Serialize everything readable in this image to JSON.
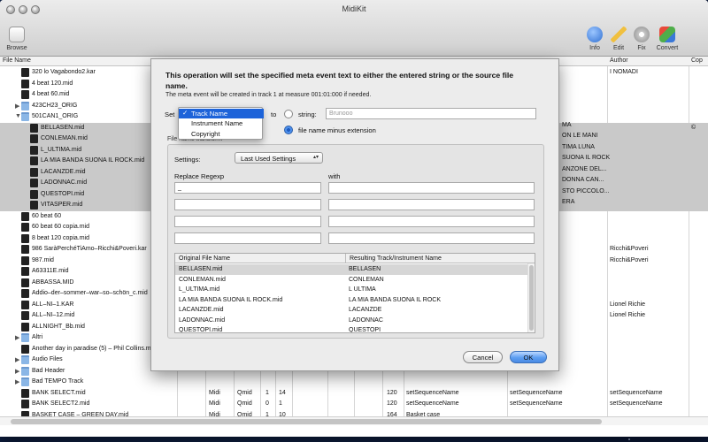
{
  "window": {
    "title": "MidiKit"
  },
  "toolbar": {
    "browse": "Browse",
    "info": "Info",
    "edit": "Edit",
    "fix": "Fix",
    "convert": "Convert"
  },
  "columns": {
    "file_name": "File Name",
    "author": "Author",
    "cop": "Cop"
  },
  "files": [
    {
      "label": "320 lo Vagabondo2.kar",
      "kind": "file",
      "author": "I NOMADI"
    },
    {
      "label": "4 beat 120.mid",
      "kind": "file"
    },
    {
      "label": "4 beat 60.mid",
      "kind": "file"
    },
    {
      "label": "423CH23_ORIG",
      "kind": "folder",
      "triangle": "▶"
    },
    {
      "label": "501CAN1_ORIG",
      "kind": "folder",
      "triangle": "▼"
    },
    {
      "label": "BELLASEN.mid",
      "kind": "file",
      "selected": true,
      "copy": "©"
    },
    {
      "label": "CONLEMAN.mid",
      "kind": "file",
      "selected": true
    },
    {
      "label": "L_ULTIMA.mid",
      "kind": "file",
      "selected": true
    },
    {
      "label": "LA MIA BANDA SUONA IL ROCK.mid",
      "kind": "file",
      "selected": true
    },
    {
      "label": "LACANZDE.mid",
      "kind": "file",
      "selected": true
    },
    {
      "label": "LADONNAC.mid",
      "kind": "file",
      "selected": true
    },
    {
      "label": "QUESTOPI.mid",
      "kind": "file",
      "selected": true
    },
    {
      "label": "VITASPER.mid",
      "kind": "file",
      "selected": true
    },
    {
      "label": "60 beat 60",
      "kind": "file"
    },
    {
      "label": "60 beat 60 copia.mid",
      "kind": "file"
    },
    {
      "label": "8 beat 120 copia.mid",
      "kind": "file"
    },
    {
      "label": "986 SaràPerchéTiAmo–Ricchi&Poveri.kar",
      "kind": "file",
      "author": "Ricchi&Poveri"
    },
    {
      "label": "987.mid",
      "kind": "file",
      "author": "Ricchi&Poveri"
    },
    {
      "label": "A63311E.mid",
      "kind": "file"
    },
    {
      "label": "ABBASSA.MID",
      "kind": "file"
    },
    {
      "label": "Addio–der–sommer–war–so–schön_c.mid",
      "kind": "file"
    },
    {
      "label": "ALL–NI–1.KAR",
      "kind": "file",
      "author": "Lionel Richie"
    },
    {
      "label": "ALL–NI–12.mid",
      "kind": "file",
      "author": "Lionel Richie"
    },
    {
      "label": "ALLNIGHT_Bb.mid",
      "kind": "file"
    },
    {
      "label": "Altri",
      "kind": "folder",
      "triangle": "▶"
    },
    {
      "label": "Another day in paradise (5) – Phil Collins.mid",
      "kind": "file"
    },
    {
      "label": "Audio Files",
      "kind": "folder",
      "triangle": "▶"
    },
    {
      "label": "Bad Header",
      "kind": "folder",
      "triangle": "▶"
    },
    {
      "label": "Bad TEMPO Track",
      "kind": "folder",
      "triangle": "▶"
    },
    {
      "label": "BANK SELECT.mid",
      "kind": "file",
      "c1": "Midi",
      "c2": "Qmid",
      "c3": "1",
      "c4": "14",
      "c5": "120",
      "ev": "setSequenceName",
      "ev2": "setSequenceName",
      "author": "setSequenceName"
    },
    {
      "label": "BANK SELECT2.mid",
      "kind": "file",
      "c1": "Midi",
      "c2": "Qmid",
      "c3": "0",
      "c4": "1",
      "c5": "120",
      "ev": "setSequenceName",
      "ev2": "setSequenceName",
      "author": "setSequenceName"
    },
    {
      "label": "BASKET CASE – GREEN DAY.mid",
      "kind": "file",
      "c1": "Midi",
      "c2": "Qmid",
      "c3": "1",
      "c4": "10",
      "c5": "164",
      "ev": "Basket case"
    }
  ],
  "background_fragments": [
    "MA",
    "ON LE MANI",
    "TIMA LUNA",
    "SUONA IL ROCK",
    "ANZONE DEL...",
    "DONNA CAN...",
    "STO PICCOLO...",
    "ERA"
  ],
  "dialog": {
    "headline": "This operation will set the specified meta event text to either the entered string or the source file name.",
    "note": "The meta event will be created in track 1 at measure 001:01:000 if needed.",
    "set_label": "Set",
    "to_label": "to",
    "string_label": "string:",
    "string_value": "Brunooo",
    "filename_label": "file name minus extension",
    "group_title": "File name transform",
    "settings_label": "Settings:",
    "settings_value": "Last Used Settings",
    "replace_label": "Replace Regexp",
    "with_label": "with",
    "replace_rows": [
      "_",
      "",
      "",
      ""
    ],
    "with_rows": [
      "",
      "",
      "",
      ""
    ],
    "table_headers": [
      "Original File Name",
      "Resulting Track/Instrument Name"
    ],
    "table_rows": [
      [
        "BELLASEN.mid",
        "BELLASEN"
      ],
      [
        "CONLEMAN.mid",
        "CONLEMAN"
      ],
      [
        "L_ULTIMA.mid",
        "L ULTIMA"
      ],
      [
        "LA MIA BANDA SUONA IL ROCK.mid",
        "LA MIA BANDA SUONA IL ROCK"
      ],
      [
        "LACANZDE.mid",
        "LACANZDE"
      ],
      [
        "LADONNAC.mid",
        "LADONNAC"
      ],
      [
        "QUESTOPI.mid",
        "QUESTOPI"
      ]
    ],
    "cancel": "Cancel",
    "ok": "OK"
  },
  "menu": {
    "items": [
      "Track Name",
      "Instrument Name",
      "Copyright"
    ],
    "selected_index": 0
  }
}
